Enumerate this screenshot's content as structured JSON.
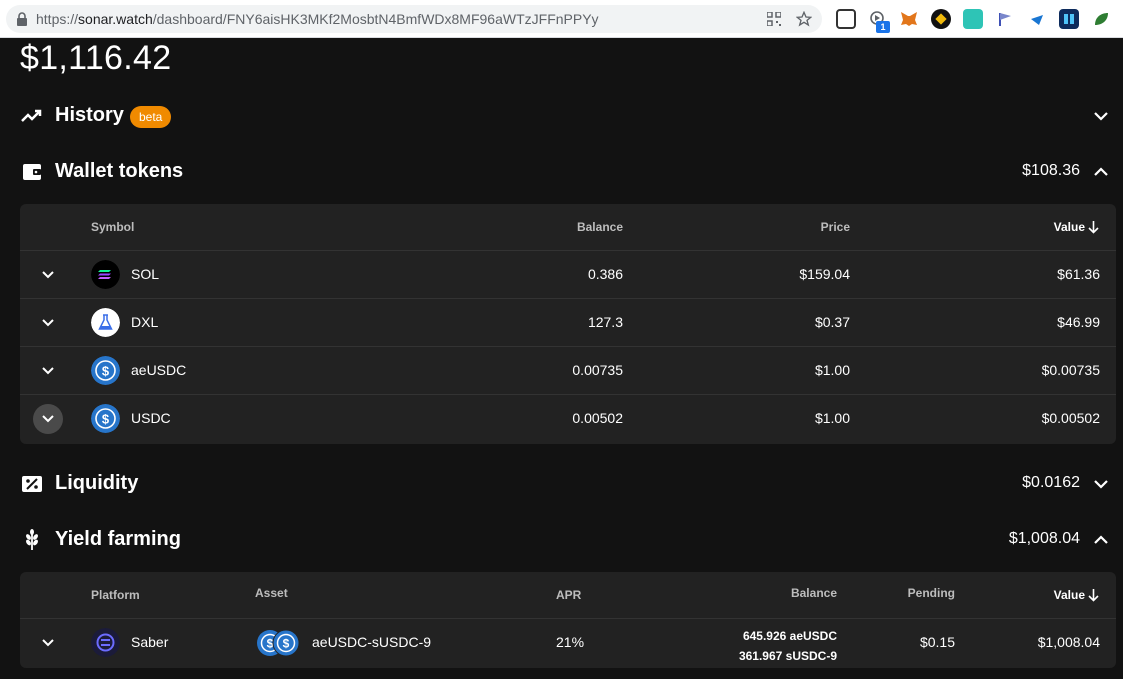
{
  "browser": {
    "url_prefix": "https://",
    "url_host": "sonar.watch",
    "url_path": "/dashboard/FNY6aisHK3MKf2MosbtN4BmfWDx8MF96aWTzJFFnPPYy",
    "extension_badge": "1",
    "extensions": [
      "qr-code-icon",
      "star-icon",
      "binance-extension-icon",
      "video-extension-icon",
      "metamask-fox-icon",
      "ens-extension-icon",
      "uniswap-extension-icon",
      "flag-extension-icon",
      "wormhole-extension-icon",
      "hex-extension-icon",
      "leaf-extension-icon"
    ]
  },
  "portfolio": {
    "total": "$1,116.42"
  },
  "sections": {
    "history": {
      "title": "History",
      "badge": "beta",
      "icon": "trend-line-icon"
    },
    "wallet": {
      "title": "Wallet tokens",
      "value": "$108.36",
      "icon": "wallet-icon"
    },
    "liquidity": {
      "title": "Liquidity",
      "value": "$0.0162",
      "icon": "liquidity-ticket-icon"
    },
    "yield": {
      "title": "Yield farming",
      "value": "$1,008.04",
      "icon": "wheat-icon"
    }
  },
  "wallet_table": {
    "headers": {
      "symbol": "Symbol",
      "balance": "Balance",
      "price": "Price",
      "value": "Value"
    },
    "rows": [
      {
        "symbol": "SOL",
        "balance": "0.386",
        "price": "$159.04",
        "value": "$61.36",
        "icon": "sol-token-icon"
      },
      {
        "symbol": "DXL",
        "balance": "127.3",
        "price": "$0.37",
        "value": "$46.99",
        "icon": "dxl-token-icon"
      },
      {
        "symbol": "aeUSDC",
        "balance": "0.00735",
        "price": "$1.00",
        "value": "$0.00735",
        "icon": "usdc-token-icon"
      },
      {
        "symbol": "USDC",
        "balance": "0.00502",
        "price": "$1.00",
        "value": "$0.00502",
        "icon": "usdc-token-icon"
      }
    ]
  },
  "yield_table": {
    "headers": {
      "platform": "Platform",
      "asset": "Asset",
      "apr": "APR",
      "balance": "Balance",
      "pending": "Pending",
      "value": "Value"
    },
    "rows": [
      {
        "platform": "Saber",
        "asset": "aeUSDC-sUSDC-9",
        "apr": "21%",
        "balance_line1": "645.926 aeUSDC",
        "balance_line2": "361.967 sUSDC-9",
        "pending": "$0.15",
        "value": "$1,008.04"
      }
    ]
  },
  "colors": {
    "background": "#121212",
    "card": "#222222",
    "accent_badge": "#f08a00",
    "usdc_blue": "#2775ca"
  }
}
